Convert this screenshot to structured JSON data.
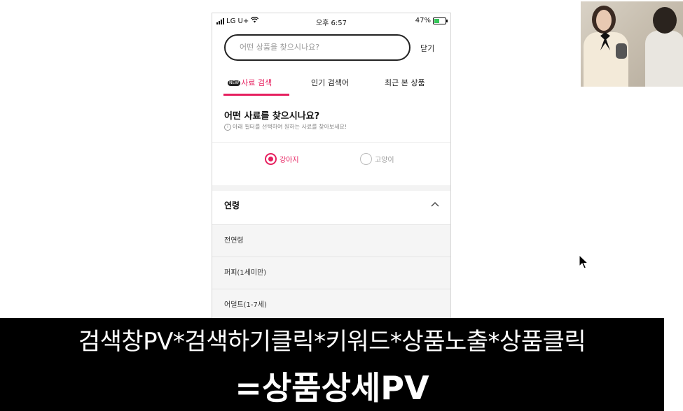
{
  "status_bar": {
    "carrier": "LG U+",
    "time": "오후 6:57",
    "battery": "47%"
  },
  "search": {
    "placeholder": "어떤 상품을 찾으시나요?",
    "close_label": "닫기"
  },
  "tabs": [
    {
      "badge": "NEW",
      "label": "사료 검색",
      "active": true
    },
    {
      "label": "인기 검색어",
      "active": false
    },
    {
      "label": "최근 본 상품",
      "active": false
    }
  ],
  "feed_search": {
    "title": "어떤 사료를 찾으시나요?",
    "subtitle": "아래 필터를 선택하여 원하는 사료를 찾아보세요!"
  },
  "pet_options": [
    {
      "label": "강아지",
      "selected": true
    },
    {
      "label": "고양이",
      "selected": false
    }
  ],
  "age_filter": {
    "title": "연령",
    "options": [
      "전연령",
      "퍼피(1세미만)",
      "어덜트(1-7세)"
    ]
  },
  "caption": {
    "line1": "검색창PV*검색하기클릭*키워드*상품노출*상품클릭",
    "line2": "=상품상세PV"
  },
  "colors": {
    "accent": "#e6205f",
    "caption_bg": "#000000"
  }
}
